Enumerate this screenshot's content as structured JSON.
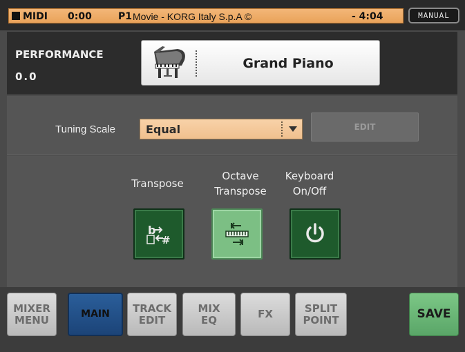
{
  "status_bar": {
    "midi_label": "MIDI",
    "time": "0:00",
    "song_slot": "P1",
    "song_title": "Movie - KORG Italy S.p.A ©",
    "time_remaining": "- 4:04",
    "mode_button": "MANUAL"
  },
  "performance": {
    "title": "PERFORMANCE",
    "value": "0.0",
    "sound_name": "Grand Piano",
    "sound_icon": "grand-piano-icon"
  },
  "tuning": {
    "label": "Tuning Scale",
    "selected_value": "Equal",
    "edit_label": "EDIT"
  },
  "controls": {
    "transpose": {
      "label": "Transpose",
      "icon": "transpose-flat-sharp-icon"
    },
    "octave_transpose": {
      "label": "Octave\nTranspose",
      "icon": "octave-transpose-icon"
    },
    "keyboard": {
      "label": "Keyboard\nOn/Off",
      "icon": "power-icon"
    }
  },
  "tabs": [
    {
      "label": "MIXER\nMENU"
    },
    {
      "label": "MAIN"
    },
    {
      "label": "TRACK\nEDIT"
    },
    {
      "label": "MIX\nEQ"
    },
    {
      "label": "FX"
    },
    {
      "label": "SPLIT\nPOINT"
    },
    {
      "label": "SAVE"
    }
  ],
  "colors": {
    "status_orange": "#f0aa63",
    "selector_peach": "#f5caa0",
    "active_tab_blue": "#23508a",
    "green_button": "#1e5a2c",
    "light_green_button": "#7cbf84",
    "save_green": "#6ab676"
  }
}
